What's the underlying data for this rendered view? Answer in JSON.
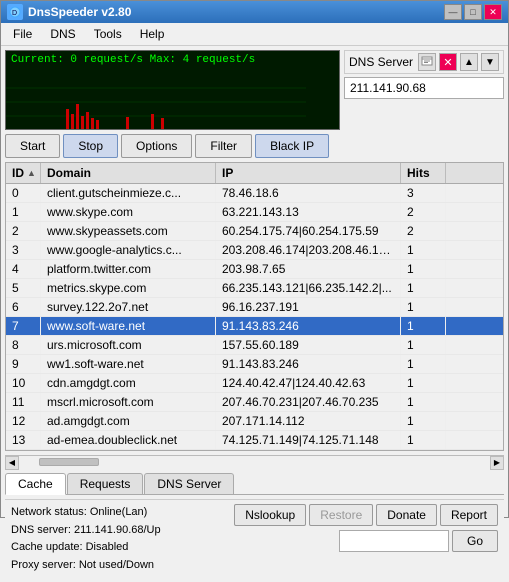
{
  "window": {
    "title": "DnsSpeeder v2.80",
    "icon": "dns-icon"
  },
  "menu": {
    "items": [
      "File",
      "DNS",
      "Tools",
      "Help"
    ]
  },
  "graph": {
    "label": "Current: 0 request/s  Max: 4 request/s"
  },
  "dns_server": {
    "label": "DNS Server",
    "ip": "211.141.90.68",
    "placeholder": ""
  },
  "toolbar": {
    "start_label": "Start",
    "stop_label": "Stop",
    "options_label": "Options",
    "filter_label": "Filter",
    "blackip_label": "Black IP"
  },
  "table": {
    "columns": [
      "ID",
      "Domain",
      "IP",
      "Hits"
    ],
    "rows": [
      {
        "id": "0",
        "domain": "client.gutscheinmieze.c...",
        "ip": "78.46.18.6",
        "hits": "3",
        "selected": false
      },
      {
        "id": "1",
        "domain": "www.skype.com",
        "ip": "63.221.143.13",
        "hits": "2",
        "selected": false
      },
      {
        "id": "2",
        "domain": "www.skypeassets.com",
        "ip": "60.254.175.74|60.254.175.59",
        "hits": "2",
        "selected": false
      },
      {
        "id": "3",
        "domain": "www.google-analytics.c...",
        "ip": "203.208.46.174|203.208.46.17...",
        "hits": "1",
        "selected": false
      },
      {
        "id": "4",
        "domain": "platform.twitter.com",
        "ip": "203.98.7.65",
        "hits": "1",
        "selected": false
      },
      {
        "id": "5",
        "domain": "metrics.skype.com",
        "ip": "66.235.143.121|66.235.142.2|...",
        "hits": "1",
        "selected": false
      },
      {
        "id": "6",
        "domain": "survey.122.2o7.net",
        "ip": "96.16.237.191",
        "hits": "1",
        "selected": false
      },
      {
        "id": "7",
        "domain": "www.soft-ware.net",
        "ip": "91.143.83.246",
        "hits": "1",
        "selected": true
      },
      {
        "id": "8",
        "domain": "urs.microsoft.com",
        "ip": "157.55.60.189",
        "hits": "1",
        "selected": false
      },
      {
        "id": "9",
        "domain": "ww1.soft-ware.net",
        "ip": "91.143.83.246",
        "hits": "1",
        "selected": false
      },
      {
        "id": "10",
        "domain": "cdn.amgdgt.com",
        "ip": "124.40.42.47|124.40.42.63",
        "hits": "1",
        "selected": false
      },
      {
        "id": "11",
        "domain": "mscrl.microsoft.com",
        "ip": "207.46.70.231|207.46.70.235",
        "hits": "1",
        "selected": false
      },
      {
        "id": "12",
        "domain": "ad.amgdgt.com",
        "ip": "207.171.14.112",
        "hits": "1",
        "selected": false
      },
      {
        "id": "13",
        "domain": "ad-emea.doubleclick.net",
        "ip": "74.125.71.149|74.125.71.148",
        "hits": "1",
        "selected": false
      }
    ]
  },
  "bottom_tabs": {
    "items": [
      "Cache",
      "Requests",
      "DNS Server"
    ],
    "active": 0
  },
  "status": {
    "network": "Network status: Online(Lan)",
    "dns_server": "DNS server:     211.141.90.68/Up",
    "cache_update": "Cache update:  Disabled",
    "proxy_server": "Proxy server:   Not used/Down"
  },
  "buttons": {
    "nslookup": "Nslookup",
    "restore": "Restore",
    "donate": "Donate",
    "report": "Report",
    "go": "Go"
  },
  "title_buttons": {
    "minimize": "—",
    "maximize": "□",
    "close": "✕"
  }
}
